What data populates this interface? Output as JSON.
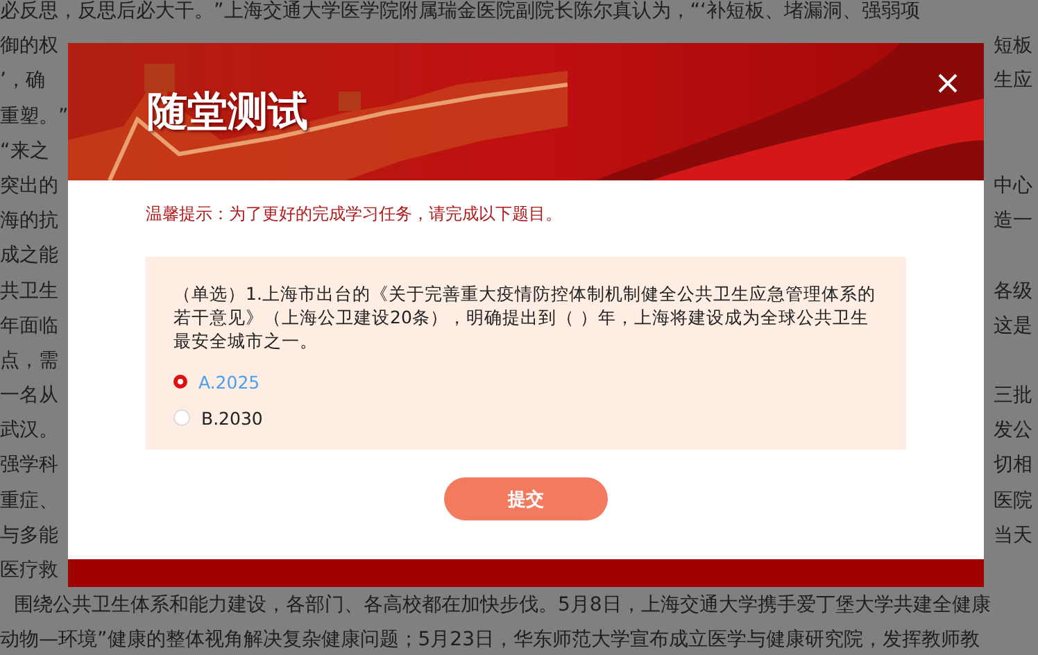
{
  "background_article": {
    "lines": [
      {
        "left": "必反思，反思后必大干。”上海交通大学医学院附属瑞金医院副院长陈尔真认为，“‘补短板、堵漏洞、强弱项"
      },
      {
        "left": "御的权",
        "right": "短板"
      },
      {
        "left": "’，确",
        "right": "生应"
      },
      {
        "left": "重塑。”"
      },
      {
        "left": "“来之"
      },
      {
        "left": "突出的",
        "right": "中心"
      },
      {
        "left": "海的抗",
        "right": "造一"
      },
      {
        "left": "成之能"
      },
      {
        "left": "共卫生",
        "right": "各级"
      },
      {
        "left": "年面临",
        "right": "这是"
      },
      {
        "left": "点，需"
      },
      {
        "left": "一名从",
        "right": "三批"
      },
      {
        "left": "武汉。",
        "right": "发公"
      },
      {
        "left": "强学科",
        "right": "切相"
      },
      {
        "left": "重症、",
        "right": "医院"
      },
      {
        "left": "与多能",
        "right": "当天"
      },
      {
        "left": "医疗救"
      },
      {
        "left": "围绕公共卫生体系和能力建设，各部门、各高校都在加快步伐。5月8日，上海交通大学携手爱丁堡大学共建全健康"
      },
      {
        "left": "动物—环境”健康的整体视角解决复杂健康问题；5月23日，华东师范大学宣布成立医学与健康研究院，发挥教师教"
      }
    ]
  },
  "dialog": {
    "title": "随堂测试",
    "hint": "温馨提示：为了更好的完成学习任务，请完成以下题目。",
    "question": {
      "text": "（单选）1.上海市出台的《关于完善重大疫情防控体制机制健全公共卫生应急管理体系的若干意见》（上海公卫建设20条），明确提出到（ ）年，上海将建设成为全球公共卫生最安全城市之一。",
      "options": [
        {
          "label": "A.2025",
          "selected": true
        },
        {
          "label": "B.2030",
          "selected": false
        }
      ]
    },
    "submit_button": "提交"
  }
}
